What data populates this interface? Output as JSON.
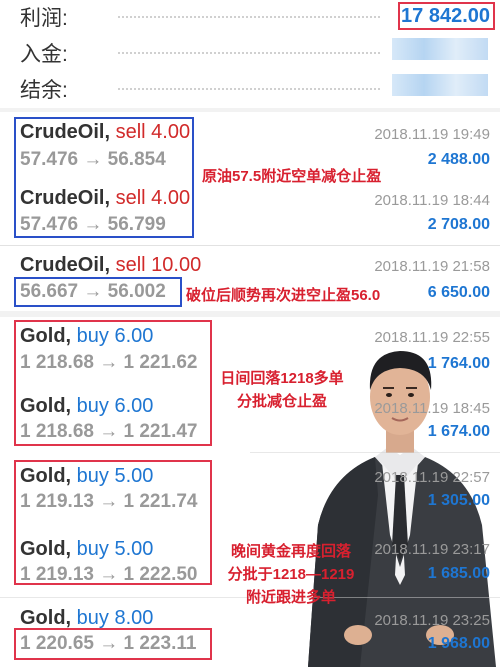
{
  "summary": {
    "profit_label": "利润:",
    "profit_value": "17 842.00",
    "deposit_label": "入金:",
    "balance_label": "结余:"
  },
  "trades": [
    {
      "symbol": "CrudeOil,",
      "side": "sell",
      "lots": "sell 4.00",
      "price": "57.476 → 56.854",
      "date": "2018.11.19 19:49",
      "profit": "2 488.00"
    },
    {
      "symbol": "CrudeOil,",
      "side": "sell",
      "lots": "sell 4.00",
      "price": "57.476 → 56.799",
      "date": "2018.11.19 18:44",
      "profit": "2 708.00"
    },
    {
      "symbol": "CrudeOil,",
      "side": "sell",
      "lots": "sell 10.00",
      "price": "56.667 → 56.002",
      "date": "2018.11.19 21:58",
      "profit": "6 650.00"
    },
    {
      "symbol": "Gold,",
      "side": "buy",
      "lots": "buy 6.00",
      "price": "1 218.68 → 1 221.62",
      "date": "2018.11.19 22:55",
      "profit": "1 764.00"
    },
    {
      "symbol": "Gold,",
      "side": "buy",
      "lots": "buy 6.00",
      "price": "1 218.68 → 1 221.47",
      "date": "2018.11.19 18:45",
      "profit": "1 674.00"
    },
    {
      "symbol": "Gold,",
      "side": "buy",
      "lots": "buy 5.00",
      "price": "1 219.13 → 1 221.74",
      "date": "2018.11.19 22:57",
      "profit": "1 305.00"
    },
    {
      "symbol": "Gold,",
      "side": "buy",
      "lots": "buy 5.00",
      "price": "1 219.13 → 1 222.50",
      "date": "2018.11.19 23:17",
      "profit": "1 685.00"
    },
    {
      "symbol": "Gold,",
      "side": "buy",
      "lots": "buy 8.00",
      "price": "1 220.65 → 1 223.11",
      "date": "2018.11.19 23:25",
      "profit": "1 968.00"
    }
  ],
  "annotations": {
    "note1": "原油57.5附近空单减仓止盈",
    "note2": "破位后顺势再次进空止盈56.0",
    "note3_line1": "日间回落1218多单",
    "note3_line2": "分批减仓止盈",
    "note4_line1": "晚间黄金再度回落",
    "note4_line2": "分批于1218—1219",
    "note4_line3": "附近跟进多单"
  },
  "colors": {
    "sell": "#d12a2a",
    "buy": "#1e76d2",
    "profit": "#1e76d2",
    "annotation": "#d8202f",
    "box_blue": "#2a50c8",
    "box_red": "#e0344b"
  }
}
